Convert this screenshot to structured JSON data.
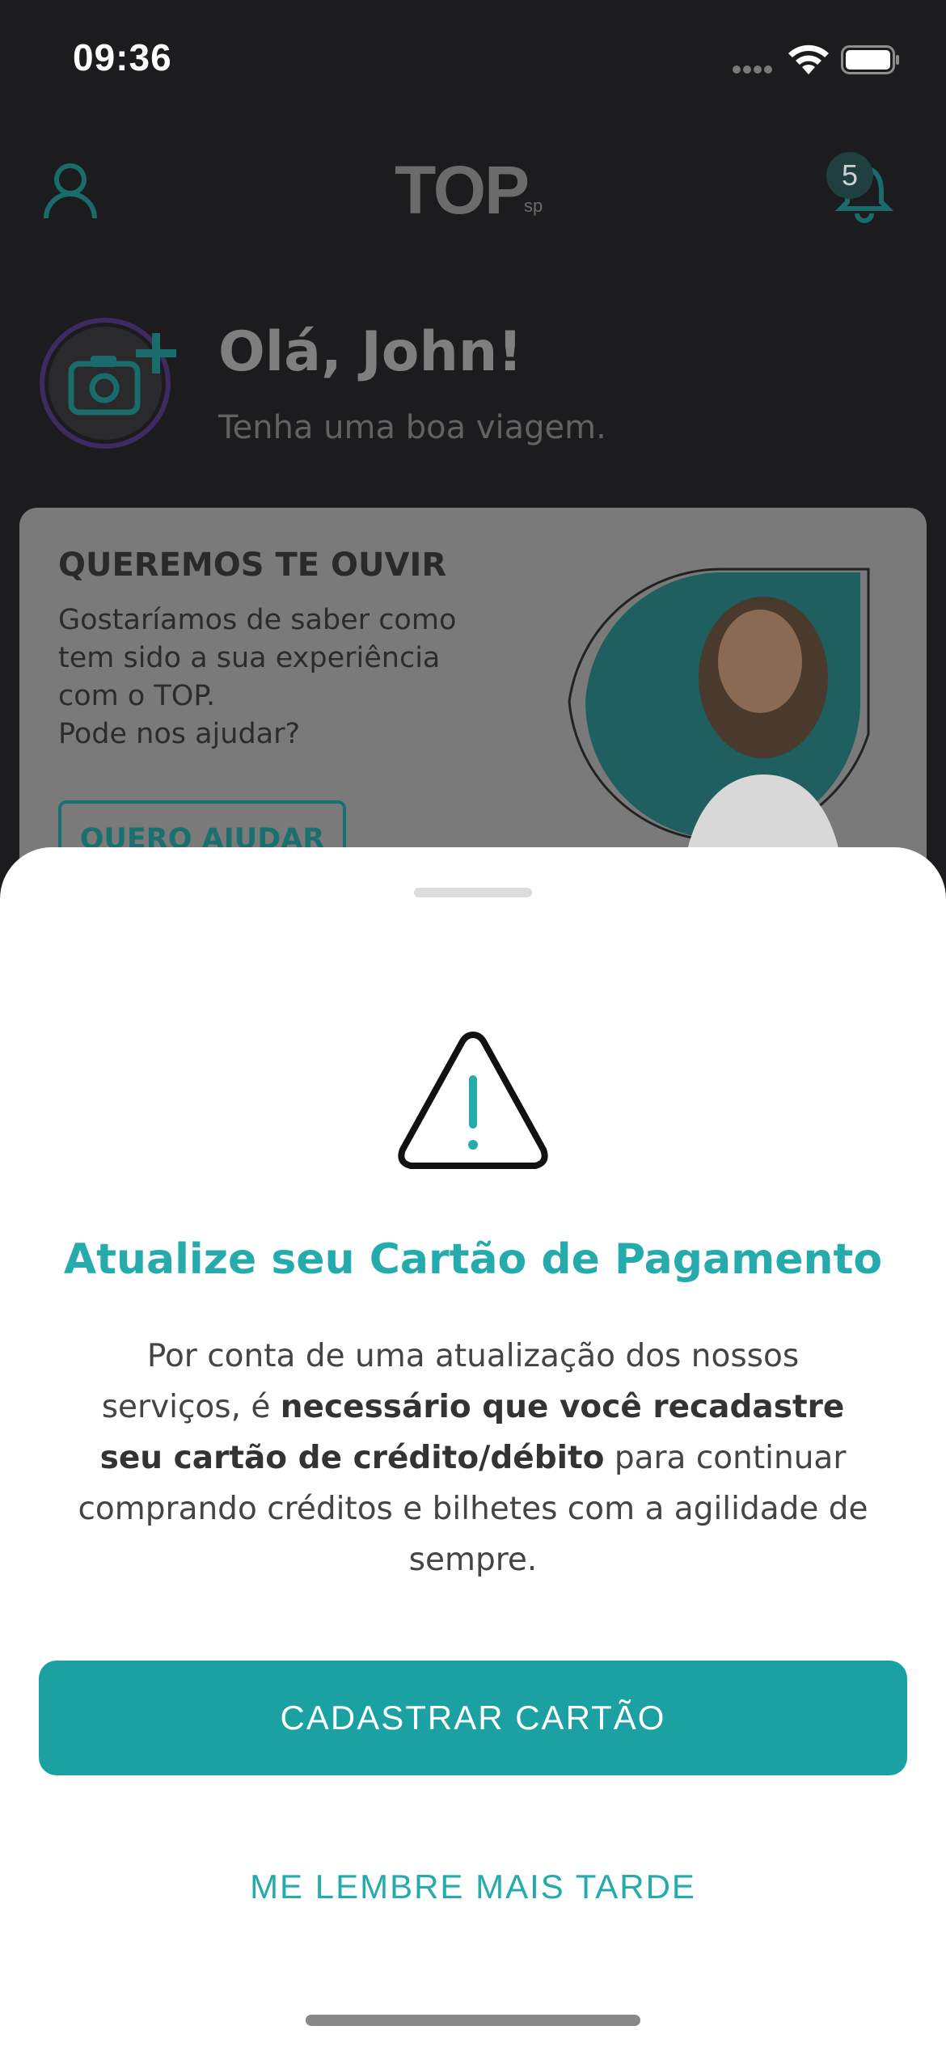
{
  "status_bar": {
    "time": "09:36"
  },
  "header": {
    "logo_text": "TOP",
    "logo_sub": "sp",
    "notification_count": "5"
  },
  "greeting": {
    "title": "Olá, John!",
    "subtitle": "Tenha uma boa viagem."
  },
  "survey_card": {
    "title": "QUEREMOS TE OUVIR",
    "text": "Gostaríamos de saber como\ntem sido a sua experiência\ncom o TOP.\nPode nos ajudar?",
    "button_label": "QUERO AJUDAR"
  },
  "sheet": {
    "title": "Atualize seu Cartão de Pagamento",
    "body_part1": "Por conta de uma atualização dos nossos serviços, é ",
    "body_bold": "necessário que você recadastre seu cartão de crédito/débito",
    "body_part2": " para continuar comprando créditos e bilhetes com a agilidade de sempre.",
    "primary_button": "CADASTRAR CARTÃO",
    "secondary_button": "ME LEMBRE MAIS TARDE"
  },
  "colors": {
    "accent": "#1ba1a1",
    "accent_text": "#25abac",
    "overlay": "#1c1c1e"
  }
}
